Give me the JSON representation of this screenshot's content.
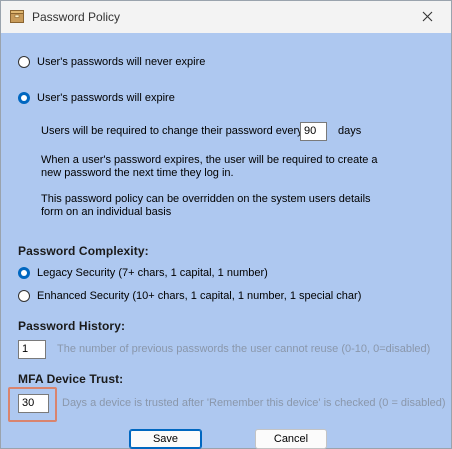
{
  "window": {
    "title": "Password Policy"
  },
  "expiry": {
    "never_label": "User's passwords will never expire",
    "expire_label": "User's passwords will expire",
    "selected": "expire",
    "change_prefix": "Users will be required to change their password every",
    "days_value": "90",
    "days_suffix": "days",
    "info_line1": "When a user's password expires, the user will be required to create a",
    "info_line2": "new password the next time they log in.",
    "override_line1": "This password policy can be overridden on the system users details",
    "override_line2": "form on an individual basis"
  },
  "complexity": {
    "heading": "Password Complexity:",
    "legacy_label": "Legacy Security (7+ chars, 1 capital, 1 number)",
    "enhanced_label": "Enhanced Security (10+ chars, 1 capital, 1 number, 1 special char)",
    "selected": "legacy"
  },
  "history": {
    "heading": "Password History:",
    "value": "1",
    "description": "The number of previous passwords the user cannot reuse (0-10, 0=disabled)"
  },
  "mfa": {
    "heading": "MFA Device Trust:",
    "value": "30",
    "description": "Days a device is trusted after 'Remember this device' is checked (0 = disabled)"
  },
  "buttons": {
    "save": "Save",
    "cancel": "Cancel"
  },
  "colors": {
    "background": "#aec8f0",
    "accent": "#0067c0",
    "highlight": "#d9846e"
  }
}
